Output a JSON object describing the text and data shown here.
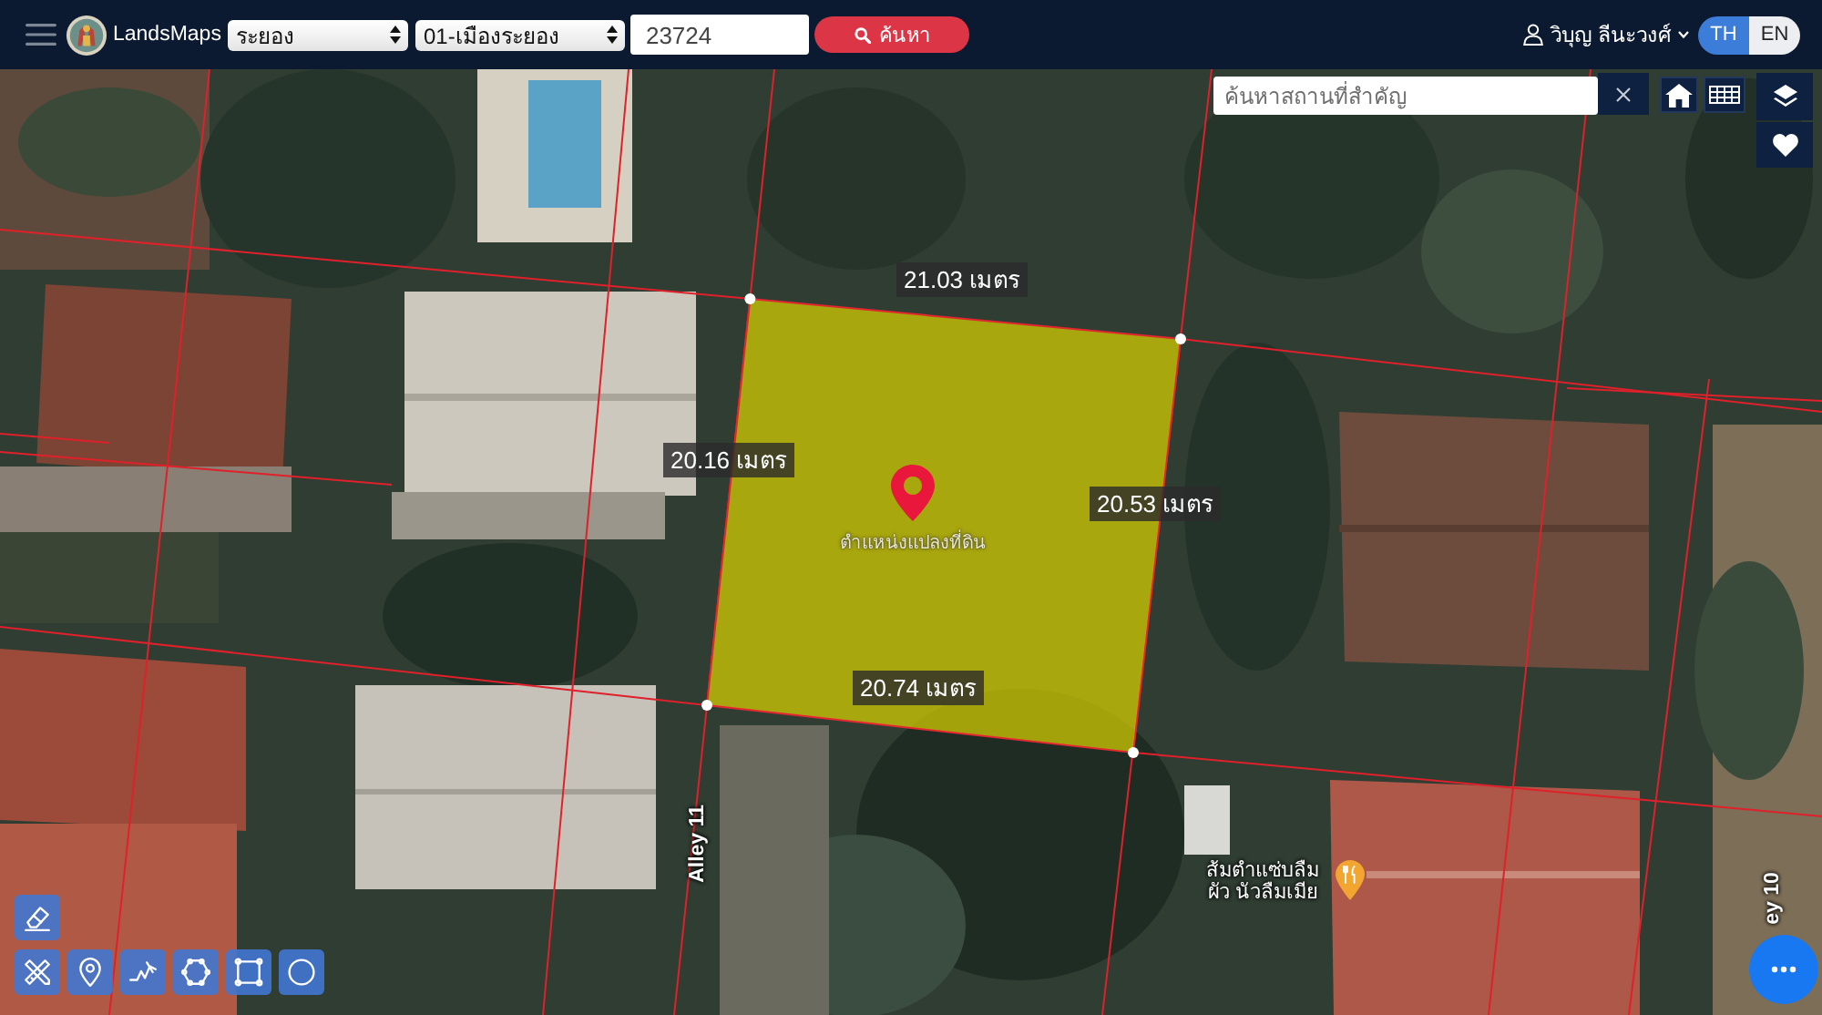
{
  "header": {
    "app_name": "LandsMaps",
    "province_select": {
      "value": "ระยอง"
    },
    "district_select": {
      "value": "01-เมืองระยอง"
    },
    "parcel_number_field": {
      "value": "23724"
    },
    "search_button": {
      "label": "ค้นหา"
    },
    "user_menu": {
      "name": "วิบุญ ลีนะวงศ์"
    },
    "language_toggle": [
      {
        "label": "TH",
        "selected": true
      },
      {
        "label": "EN",
        "selected": false
      }
    ]
  },
  "map": {
    "place_search": {
      "placeholder": "ค้นหาสถานที่สำคัญ"
    },
    "parcel_marker": {
      "label": "ตำแหน่งแปลงที่ดิน"
    },
    "edge_lengths": [
      "21.03 เมตร",
      "20.16 เมตร",
      "20.53 เมตร",
      "20.74 เมตร"
    ],
    "street_labels": [
      "Alley 11",
      "ey 10"
    ],
    "poi": {
      "label": "ส้มตำแซ่บลืม\nผัว นัวลืมเมีย"
    }
  }
}
